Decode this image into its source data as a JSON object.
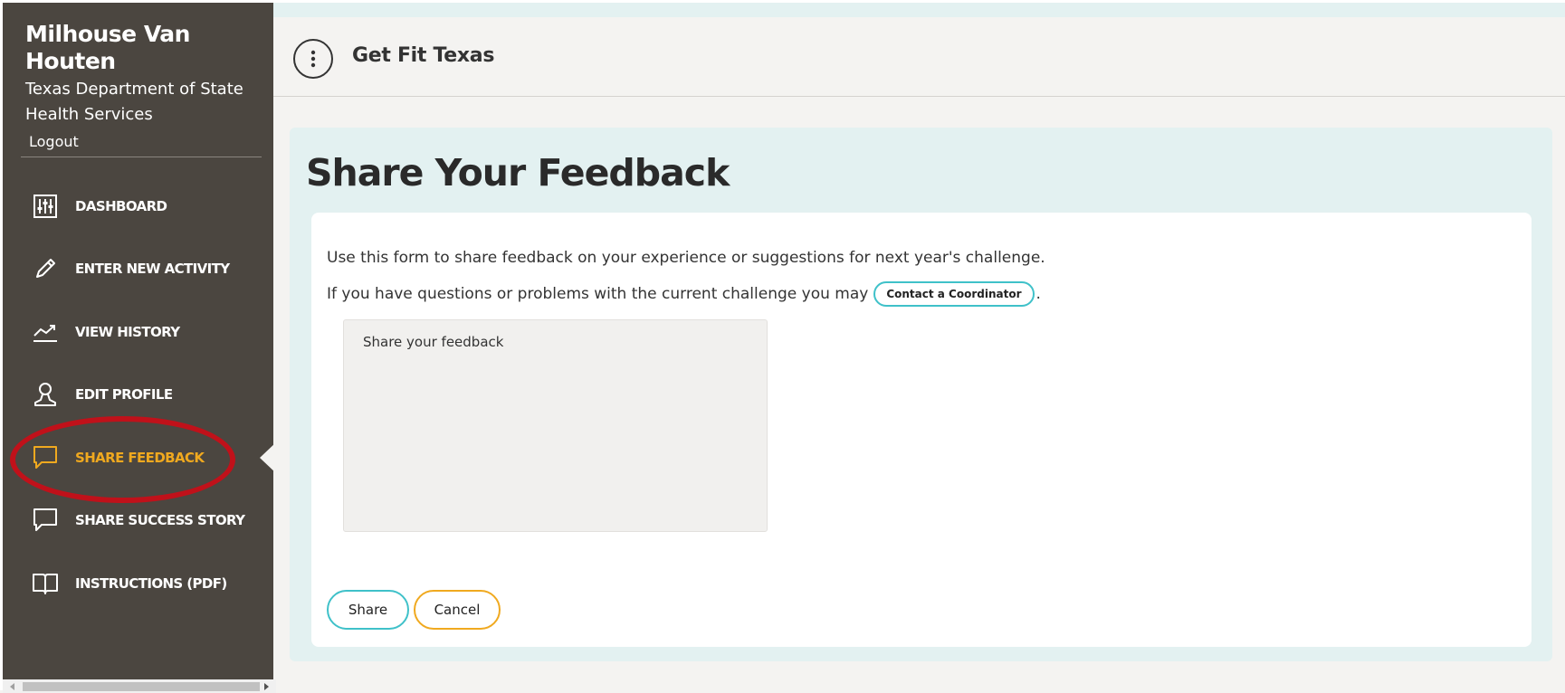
{
  "sidebar": {
    "user_name": "Milhouse Van Houten",
    "organization": "Texas Department of State Health Services",
    "logout_label": "Logout",
    "items": [
      {
        "label": "DASHBOARD",
        "icon": "dashboard-sliders-icon"
      },
      {
        "label": "ENTER NEW ACTIVITY",
        "icon": "pencil-icon"
      },
      {
        "label": "VIEW HISTORY",
        "icon": "trend-chart-icon"
      },
      {
        "label": "EDIT PROFILE",
        "icon": "person-icon"
      },
      {
        "label": "SHARE FEEDBACK",
        "icon": "speech-bubble-icon",
        "active": true
      },
      {
        "label": "SHARE SUCCESS STORY",
        "icon": "speech-bubble-icon"
      },
      {
        "label": "INSTRUCTIONS (PDF)",
        "icon": "open-book-icon"
      }
    ]
  },
  "header": {
    "menu_icon": "vertical-dots-icon",
    "app_title": "Get Fit Texas"
  },
  "main": {
    "title": "Share Your Feedback",
    "intro_text": "Use this form to share feedback on your experience or suggestions for next year's challenge.",
    "question_text": "If you have questions or problems with the current challenge you may",
    "contact_button_label": "Contact a Coordinator",
    "question_suffix": ".",
    "feedback": {
      "placeholder": "Share your feedback",
      "value": ""
    },
    "share_label": "Share",
    "cancel_label": "Cancel"
  },
  "colors": {
    "sidebar_bg": "#4b4640",
    "active_accent": "#f0a91f",
    "teal_accent": "#3fc1c9",
    "panel_bg": "#e3f1f1",
    "highlight_ring": "#c0111a"
  }
}
